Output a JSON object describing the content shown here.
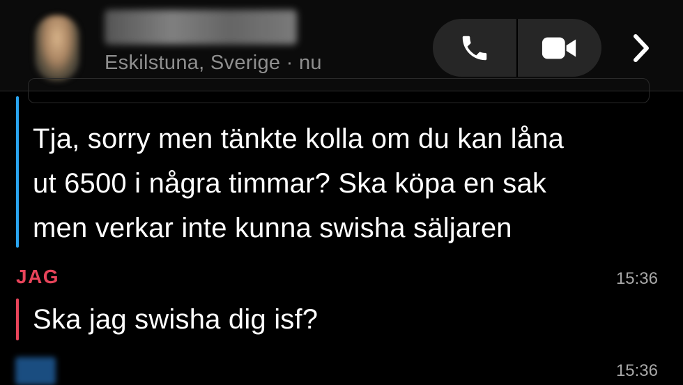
{
  "header": {
    "subtitle": "Eskilstuna, Sverige · nu"
  },
  "icons": {
    "phone": "phone-icon",
    "video": "video-camera-icon",
    "chevron": "chevron-right-icon"
  },
  "messages": [
    {
      "lines": [
        "Tja, sorry men tänkte kolla om du kan låna",
        "ut 6500 i några timmar? Ska köpa en sak",
        "men verkar inte kunna swisha säljaren"
      ],
      "bar_color": "#2aa5f0"
    },
    {
      "sender": "JAG",
      "time": "15:36",
      "text": "Ska jag swisha dig isf?",
      "bar_color": "#e8445a"
    },
    {
      "time": "15:36"
    }
  ],
  "colors": {
    "background": "#000000",
    "header": "#0b0b0b",
    "self_accent": "#e8445a",
    "friend_accent": "#2aa5f0",
    "pill": "#262626"
  }
}
